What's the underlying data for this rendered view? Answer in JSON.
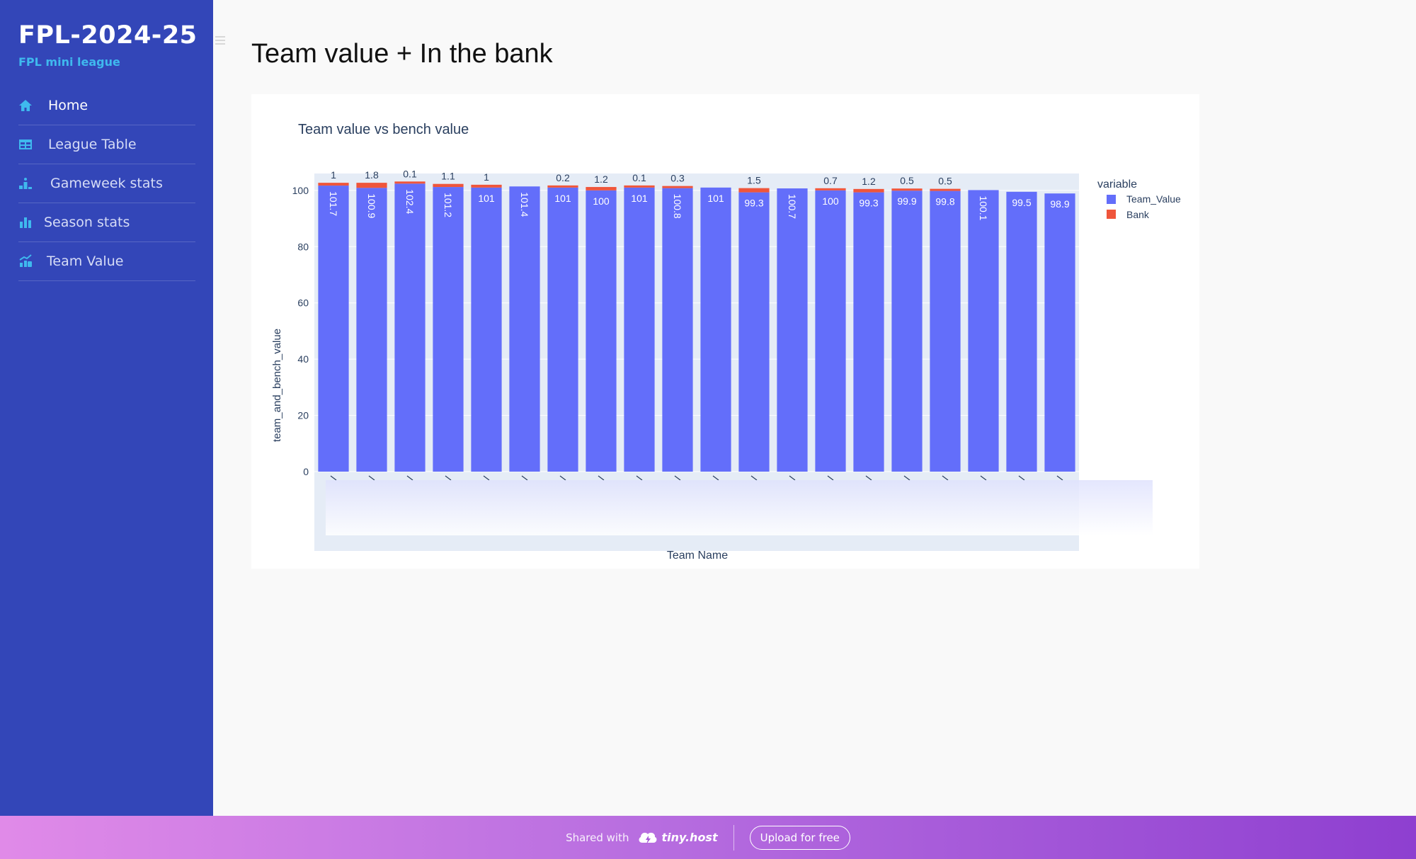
{
  "sidebar": {
    "title": "FPL-2024-25",
    "subtitle": "FPL mini league",
    "items": [
      {
        "label": "Home",
        "icon": "home-icon"
      },
      {
        "label": "League Table",
        "icon": "table-icon"
      },
      {
        "label": "Gameweek stats",
        "icon": "podium-icon"
      },
      {
        "label": "Season stats",
        "icon": "bar-chart-icon"
      },
      {
        "label": "Team Value",
        "icon": "money-chart-icon"
      }
    ]
  },
  "page": {
    "title": "Team value + In the bank"
  },
  "chart_data": {
    "type": "bar",
    "stacked": true,
    "title": "Team value vs bench value",
    "xlabel": "Team Name",
    "ylabel": "team_and_bench_value",
    "ylim": [
      0,
      106
    ],
    "yticks": [
      0,
      20,
      40,
      60,
      80,
      100
    ],
    "legend_title": "variable",
    "legend_position": "top-right",
    "series": [
      {
        "name": "Team_Value",
        "color": "#636efa",
        "values": [
          101.7,
          100.9,
          102.4,
          101.2,
          101,
          101.4,
          101,
          100,
          101,
          100.8,
          101,
          99.3,
          100.7,
          100,
          99.3,
          99.9,
          99.8,
          100.1,
          99.5,
          98.9
        ]
      },
      {
        "name": "Bank",
        "color": "#ef553b",
        "values": [
          1,
          1.8,
          0.1,
          1.1,
          1,
          0,
          0.2,
          1.2,
          0.1,
          0.3,
          0,
          1.5,
          0,
          0.7,
          1.2,
          0.5,
          0.5,
          0,
          0,
          0
        ]
      }
    ],
    "team_value_labels": [
      "101.7",
      "100.9",
      "102.4",
      "101.2",
      "101",
      "101.4",
      "101",
      "100",
      "101",
      "100.8",
      "101",
      "99.3",
      "100.7",
      "100",
      "99.3",
      "99.9",
      "99.8",
      "100.1",
      "99.5",
      "98.9"
    ],
    "team_value_label_rotated": [
      true,
      true,
      true,
      true,
      false,
      true,
      false,
      false,
      false,
      true,
      false,
      false,
      true,
      false,
      false,
      false,
      false,
      true,
      false,
      false
    ],
    "bank_labels": [
      "1",
      "1.8",
      "0.1",
      "1.1",
      "1",
      "",
      "0.2",
      "1.2",
      "0.1",
      "0.3",
      "",
      "1.5",
      "",
      "0.7",
      "1.2",
      "0.5",
      "0.5",
      "",
      "",
      ""
    ]
  },
  "footer": {
    "shared_text": "Shared with",
    "brand": "tiny.host",
    "upload_label": "Upload for free"
  }
}
